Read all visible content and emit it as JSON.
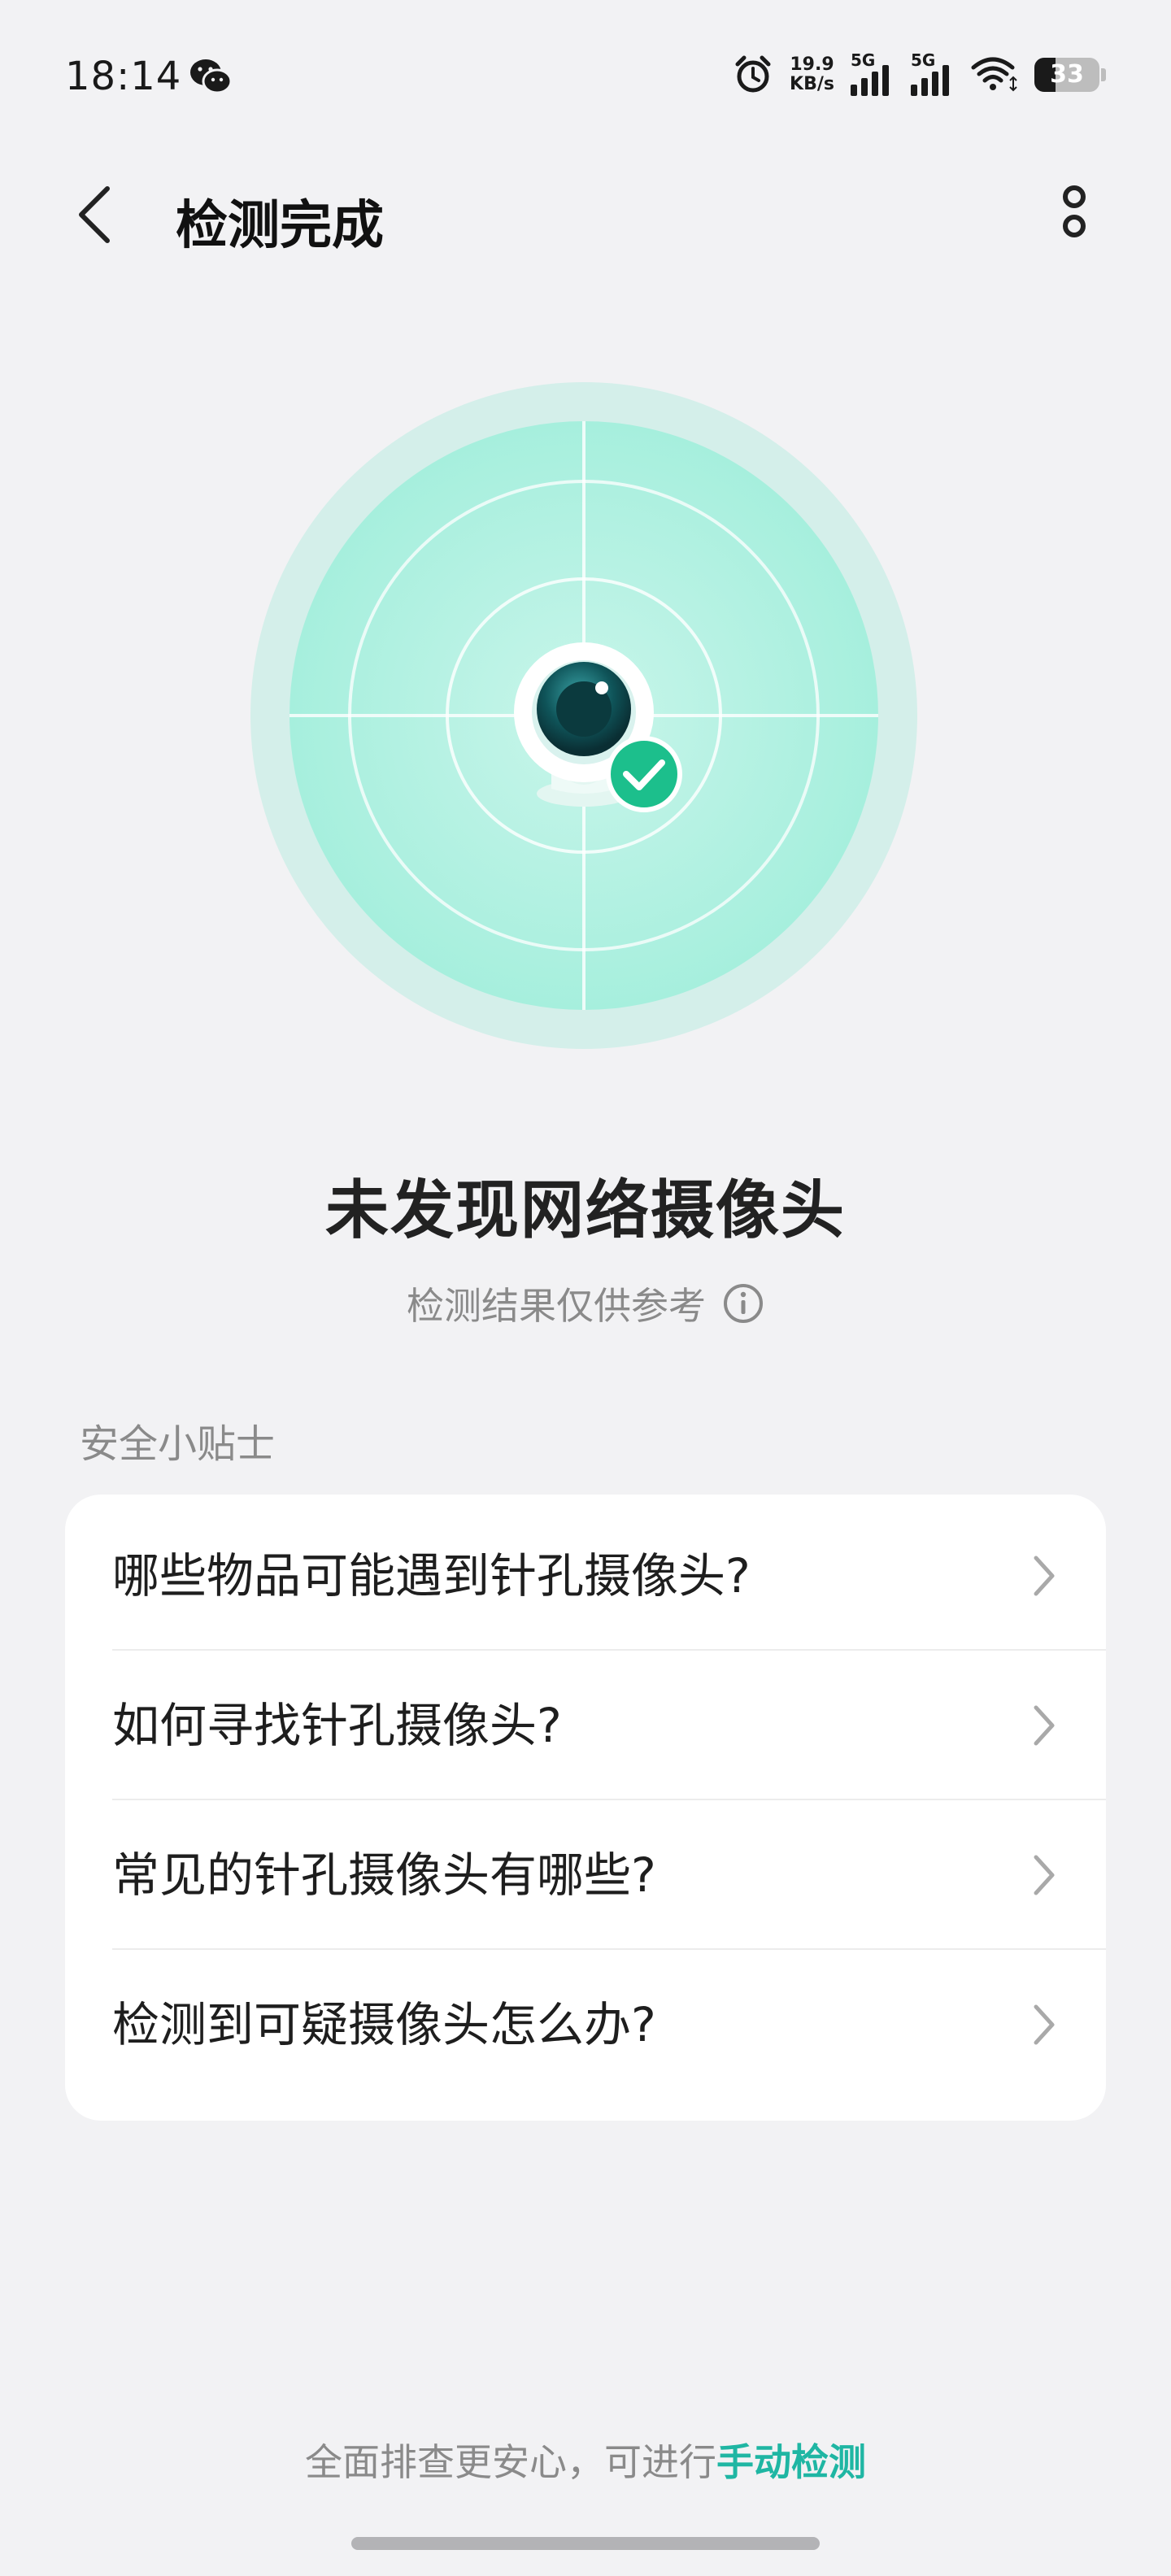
{
  "status_bar": {
    "time": "18:14",
    "speed_value": "19.9",
    "speed_unit": "KB/s",
    "signal1_label": "5G",
    "signal2_label": "5G",
    "battery": "33",
    "battery_level": 0.33,
    "icons": [
      "wechat-icon",
      "alarm-icon",
      "signal-icon",
      "wifi-icon",
      "battery-icon"
    ]
  },
  "header": {
    "title": "检测完成"
  },
  "result": {
    "title": "未发现网络摄像头",
    "subtitle": "检测结果仅供参考"
  },
  "tips": {
    "section_label": "安全小贴士",
    "items": [
      {
        "label": "哪些物品可能遇到针孔摄像头?"
      },
      {
        "label": "如何寻找针孔摄像头?"
      },
      {
        "label": "常见的针孔摄像头有哪些?"
      },
      {
        "label": "检测到可疑摄像头怎么办?"
      }
    ]
  },
  "footer": {
    "text": "全面排查更安心，可进行",
    "link": "手动检测"
  },
  "colors": {
    "accent": "#1fb6a3",
    "radar_outer": "#d4efea",
    "radar_inner": "#aef0e0",
    "check_green": "#1cbf8c",
    "background": "#f2f2f4"
  }
}
